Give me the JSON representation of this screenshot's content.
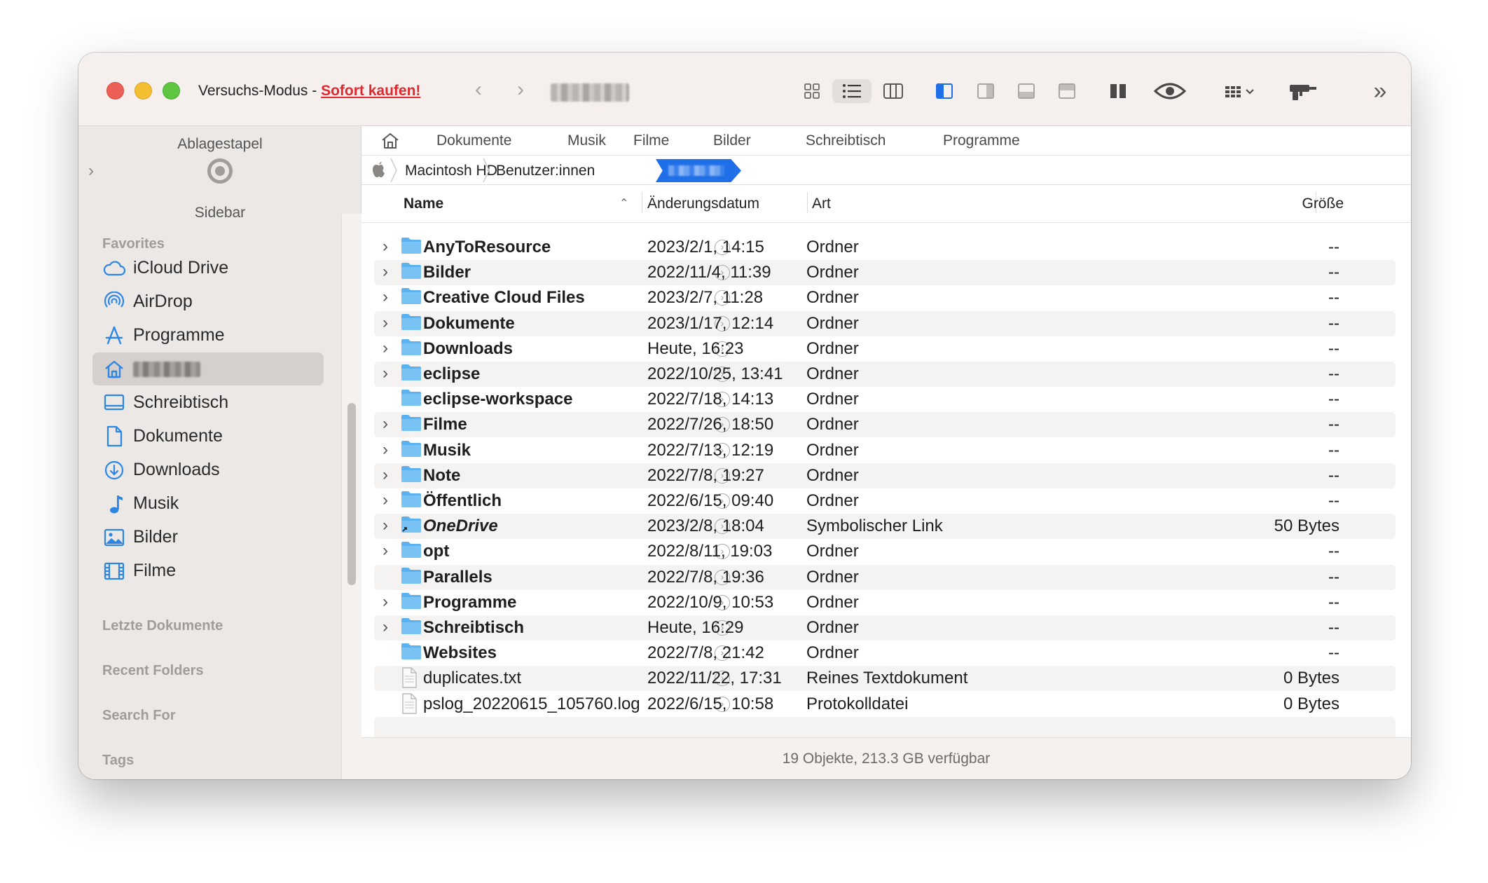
{
  "titlebar": {
    "trial_text": "Versuchs-Modus - ",
    "buy_link": "Sofort kaufen!"
  },
  "sidebar": {
    "shelf_title": "Ablagestapel",
    "shelf_subtitle": "Sidebar",
    "favorites_label": "Favorites",
    "items": [
      {
        "label": "iCloud Drive",
        "icon": "cloud-icon"
      },
      {
        "label": "AirDrop",
        "icon": "airdrop-icon"
      },
      {
        "label": "Programme",
        "icon": "applications-icon"
      },
      {
        "label": "",
        "icon": "home-icon",
        "selected": true
      },
      {
        "label": "Schreibtisch",
        "icon": "desktop-icon"
      },
      {
        "label": "Dokumente",
        "icon": "document-icon"
      },
      {
        "label": "Downloads",
        "icon": "download-icon"
      },
      {
        "label": "Musik",
        "icon": "music-note-icon"
      },
      {
        "label": "Bilder",
        "icon": "photo-icon"
      },
      {
        "label": "Filme",
        "icon": "film-icon"
      }
    ],
    "recent_docs_label": "Letzte Dokumente",
    "recent_folders_label": "Recent Folders",
    "search_for_label": "Search For",
    "tags_label": "Tags"
  },
  "favbar": {
    "items": [
      "Dokumente",
      "Musik",
      "Filme",
      "Bilder",
      "Schreibtisch",
      "Programme"
    ]
  },
  "path": {
    "crumbs": [
      "Macintosh HD",
      "Benutzer:innen"
    ]
  },
  "columns": {
    "name": "Name",
    "date": "Änderungsdatum",
    "kind": "Art",
    "size": "Größe"
  },
  "files": [
    {
      "name": "AnyToResource",
      "date": "2023/2/1, 14:15",
      "kind": "Ordner",
      "size": "--",
      "expandable": true,
      "type": "folder"
    },
    {
      "name": "Bilder",
      "date": "2022/11/4, 11:39",
      "kind": "Ordner",
      "size": "--",
      "expandable": true,
      "type": "folder"
    },
    {
      "name": "Creative Cloud Files",
      "date": "2023/2/7, 11:28",
      "kind": "Ordner",
      "size": "--",
      "expandable": true,
      "type": "folder"
    },
    {
      "name": "Dokumente",
      "date": "2023/1/17, 12:14",
      "kind": "Ordner",
      "size": "--",
      "expandable": true,
      "type": "folder"
    },
    {
      "name": "Downloads",
      "date": "Heute, 16:23",
      "kind": "Ordner",
      "size": "--",
      "expandable": true,
      "type": "folder"
    },
    {
      "name": "eclipse",
      "date": "2022/10/25, 13:41",
      "kind": "Ordner",
      "size": "--",
      "expandable": true,
      "type": "folder"
    },
    {
      "name": "eclipse-workspace",
      "date": "2022/7/18, 14:13",
      "kind": "Ordner",
      "size": "--",
      "expandable": false,
      "type": "folder"
    },
    {
      "name": "Filme",
      "date": "2022/7/26, 18:50",
      "kind": "Ordner",
      "size": "--",
      "expandable": true,
      "type": "folder"
    },
    {
      "name": "Musik",
      "date": "2022/7/13, 12:19",
      "kind": "Ordner",
      "size": "--",
      "expandable": true,
      "type": "folder"
    },
    {
      "name": "Note",
      "date": "2022/7/8, 19:27",
      "kind": "Ordner",
      "size": "--",
      "expandable": true,
      "type": "folder"
    },
    {
      "name": "Öffentlich",
      "date": "2022/6/15, 09:40",
      "kind": "Ordner",
      "size": "--",
      "expandable": true,
      "type": "folder"
    },
    {
      "name": "OneDrive",
      "date": "2023/2/8, 18:04",
      "kind": "Symbolischer Link",
      "size": "50 Bytes",
      "expandable": true,
      "type": "alias"
    },
    {
      "name": "opt",
      "date": "2022/8/11, 19:03",
      "kind": "Ordner",
      "size": "--",
      "expandable": true,
      "type": "folder"
    },
    {
      "name": "Parallels",
      "date": "2022/7/8, 19:36",
      "kind": "Ordner",
      "size": "--",
      "expandable": false,
      "type": "folder"
    },
    {
      "name": "Programme",
      "date": "2022/10/9, 10:53",
      "kind": "Ordner",
      "size": "--",
      "expandable": true,
      "type": "folder"
    },
    {
      "name": "Schreibtisch",
      "date": "Heute, 16:29",
      "kind": "Ordner",
      "size": "--",
      "expandable": true,
      "type": "folder"
    },
    {
      "name": "Websites",
      "date": "2022/7/8, 21:42",
      "kind": "Ordner",
      "size": "--",
      "expandable": false,
      "type": "folder"
    },
    {
      "name": "duplicates.txt",
      "date": "2022/11/22, 17:31",
      "kind": "Reines Textdokument",
      "size": "0 Bytes",
      "expandable": false,
      "type": "file"
    },
    {
      "name": "pslog_20220615_105760.log",
      "date": "2022/6/15, 10:58",
      "kind": "Protokolldatei",
      "size": "0 Bytes",
      "expandable": false,
      "type": "file"
    }
  ],
  "status": "19 Objekte, 213.3 GB verfügbar",
  "colors": {
    "accent": "#1f6fe8",
    "folder": "#5cb2ef",
    "buy_link": "#e0282e"
  }
}
